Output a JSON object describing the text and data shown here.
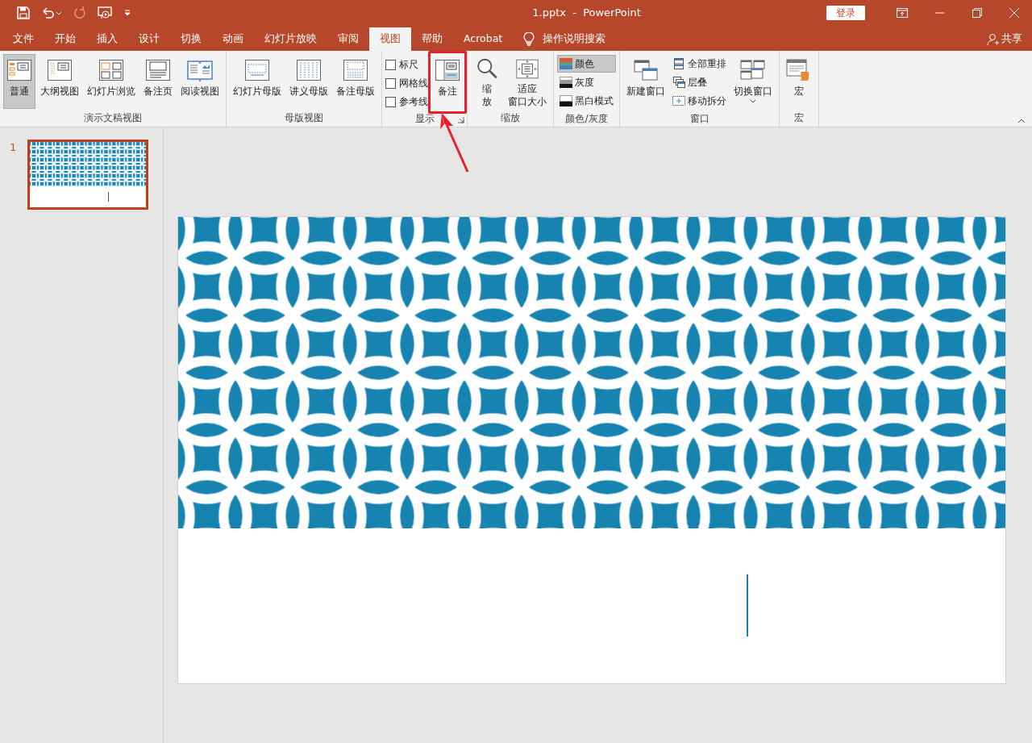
{
  "title_bar": {
    "quick_access": [
      {
        "kind": "save",
        "disabled": false
      },
      {
        "kind": "undo",
        "disabled": false
      },
      {
        "kind": "redo",
        "disabled": true
      },
      {
        "kind": "present",
        "disabled": false
      },
      {
        "kind": "customize",
        "disabled": false
      }
    ],
    "title": "1.pptx  -  PowerPoint",
    "login": "登录"
  },
  "tabs": [
    {
      "label": "文件",
      "selected": false
    },
    {
      "label": "开始",
      "selected": false
    },
    {
      "label": "插入",
      "selected": false
    },
    {
      "label": "设计",
      "selected": false
    },
    {
      "label": "切换",
      "selected": false
    },
    {
      "label": "动画",
      "selected": false
    },
    {
      "label": "幻灯片放映",
      "selected": false
    },
    {
      "label": "审阅",
      "selected": false
    },
    {
      "label": "视图",
      "selected": true
    },
    {
      "label": "帮助",
      "selected": false
    },
    {
      "label": "Acrobat",
      "selected": false
    }
  ],
  "tell_me": "操作说明搜索",
  "share": "共享",
  "ribbon": {
    "groups": [
      {
        "name": "演示文稿视图",
        "items": [
          {
            "kind": "large",
            "label": "普通",
            "selected": true
          },
          {
            "kind": "large",
            "label": "大纲视图",
            "selected": false
          },
          {
            "kind": "large",
            "label": "幻灯片浏览",
            "selected": false
          },
          {
            "kind": "large",
            "label": "备注页",
            "selected": false
          },
          {
            "kind": "large",
            "label": "阅读视图",
            "selected": false
          }
        ]
      },
      {
        "name": "母版视图",
        "items": [
          {
            "kind": "large",
            "label": "幻灯片母版",
            "selected": false
          },
          {
            "kind": "large",
            "label": "讲义母版",
            "selected": false
          },
          {
            "kind": "large",
            "label": "备注母版",
            "selected": false
          }
        ]
      },
      {
        "name": "显示",
        "launcher": true,
        "items": [
          {
            "kind": "checkbox",
            "label": "标尺",
            "checked": false
          },
          {
            "kind": "checkbox",
            "label": "网格线",
            "checked": false
          },
          {
            "kind": "checkbox",
            "label": "参考线",
            "checked": false
          },
          {
            "kind": "large",
            "label": "备注",
            "selected": false,
            "highlighted": true
          }
        ]
      },
      {
        "name": "缩放",
        "items": [
          {
            "kind": "large",
            "lines": [
              "缩",
              "放"
            ],
            "selected": false
          },
          {
            "kind": "large",
            "lines": [
              "适应",
              "窗口大小"
            ],
            "selected": false
          }
        ]
      },
      {
        "name": "颜色/灰度",
        "items": [
          {
            "kind": "small",
            "label": "颜色",
            "selected": true
          },
          {
            "kind": "small",
            "label": "灰度",
            "selected": false
          },
          {
            "kind": "small",
            "label": "黑白模式",
            "selected": false
          }
        ]
      },
      {
        "name": "窗口",
        "items": [
          {
            "kind": "large",
            "label": "新建窗口",
            "selected": false
          },
          {
            "kind": "small",
            "label": "全部重排",
            "selected": false
          },
          {
            "kind": "small",
            "label": "层叠",
            "selected": false
          },
          {
            "kind": "small",
            "label": "移动拆分",
            "selected": false
          },
          {
            "kind": "large",
            "label": "切换窗口",
            "selected": false,
            "dropdown": true
          }
        ]
      },
      {
        "name": "宏",
        "items": [
          {
            "kind": "large",
            "label": "宏",
            "selected": false
          }
        ]
      }
    ]
  },
  "slides": [
    {
      "number": "1",
      "selected": true
    }
  ]
}
